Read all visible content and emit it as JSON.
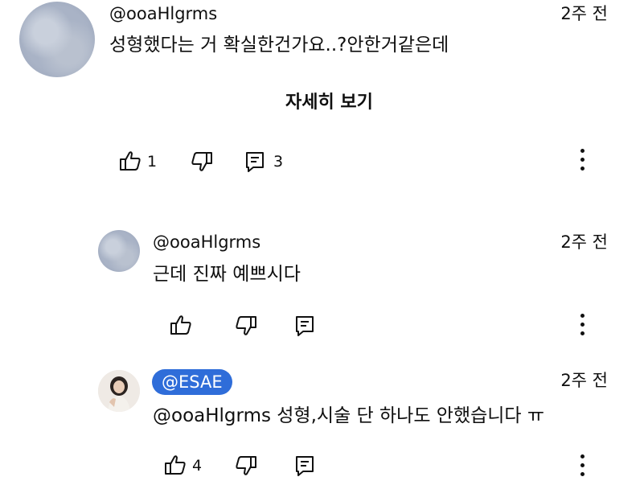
{
  "comments": [
    {
      "handle": "@ooaHlgrms",
      "time": "2주 전",
      "text": "성형했다는 거 확실한건가요..?안한거같은데",
      "likes": "1",
      "replies": "3",
      "more_label": "자세히 보기"
    },
    {
      "handle": "@ooaHlgrms",
      "time": "2주 전",
      "text": "근데 진짜 예쁘시다",
      "likes": ""
    },
    {
      "handle": "@ESAE",
      "time": "2주 전",
      "text": "@ooaHlgrms 성형,시술 단 하나도 안했습니다 ㅠ",
      "likes": "4"
    }
  ],
  "icons": {
    "like": "thumbs-up-icon",
    "dislike": "thumbs-down-icon",
    "reply": "comment-icon",
    "more": "more-vertical-icon"
  },
  "colors": {
    "badge": "#2f6dd9"
  }
}
